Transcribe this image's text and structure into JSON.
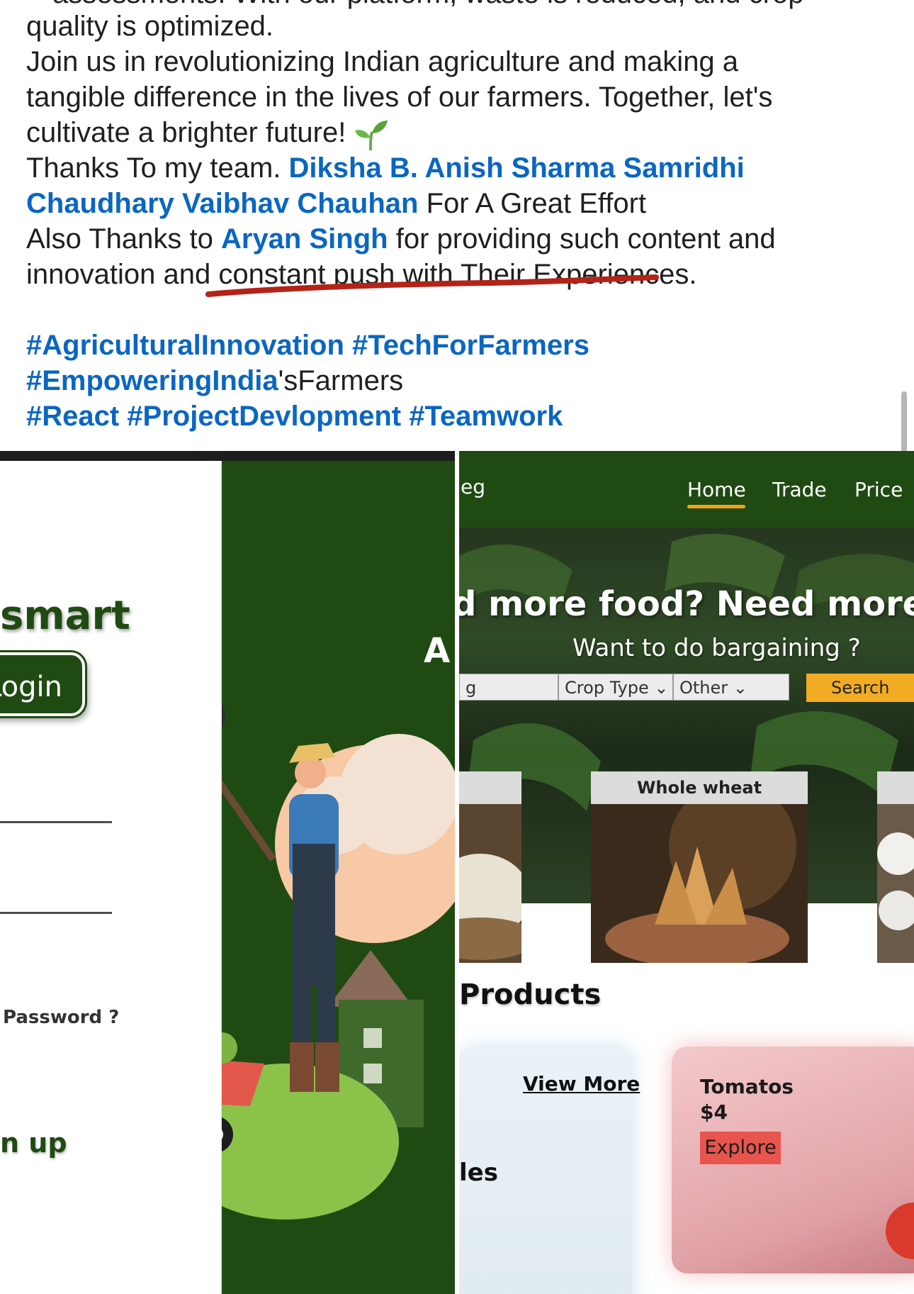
{
  "post": {
    "cut_line": "assessments. With our platform, waste is reduced, and crop",
    "line1": "quality is optimized.",
    "line2": "Join us in revolutionizing Indian agriculture and making a",
    "line3": "tangible difference in the lives of our farmers. Together, let's",
    "line4": "cultivate a brighter future!",
    "line5_prefix": "Thanks To my team.",
    "mentions_team_line1": "Diksha B. Anish Sharma Samridhi",
    "mentions_team_line2": "Chaudhary Vaibhav Chauhan",
    "line6_suffix": "For A Great Effort",
    "line7_prefix": "Also Thanks to",
    "mention_aryan": "Aryan Singh",
    "line7_suffix": "for providing such content and",
    "line8": "innovation and constant push with Their Experiences.",
    "hashtags_line1": "#AgriculturalInnovation #TechForFarmers",
    "hashtag_line2_tag": "#EmpoweringIndia",
    "hashtag_line2_suffix": "'sFarmers",
    "hashtags_line3": "#React #ProjectDevlopment #Teamwork"
  },
  "left_screenshot": {
    "smart_text": "smart",
    "login_label": "Login",
    "forgot_text": "Password ?",
    "signup_text": "n up",
    "a_letter": "A"
  },
  "right_screenshot": {
    "logo_fragment": "eg",
    "nav": {
      "home": "Home",
      "trade": "Trade",
      "price": "Price"
    },
    "hero_headline": "d more food? Need more fa",
    "hero_sub": "Want to do bargaining ?",
    "search": {
      "first_fragment": "g",
      "crop_type": "Crop Type",
      "other": "Other",
      "search_button": "Search"
    },
    "card_label": "Whole wheat",
    "products_title": "Products",
    "view_more": "View More",
    "les_fragment": "les",
    "product": {
      "name": "Tomatos",
      "price": "$4",
      "explore": "Explore"
    }
  },
  "colors": {
    "link_blue": "#0a66c2",
    "farm_green": "#1f4b12",
    "search_orange": "#f2ac24",
    "explore_red": "#e7554c",
    "nav_underline": "#f4a21d"
  },
  "icons": [
    "sprout-emoji-icon",
    "chevron-down-icon"
  ]
}
